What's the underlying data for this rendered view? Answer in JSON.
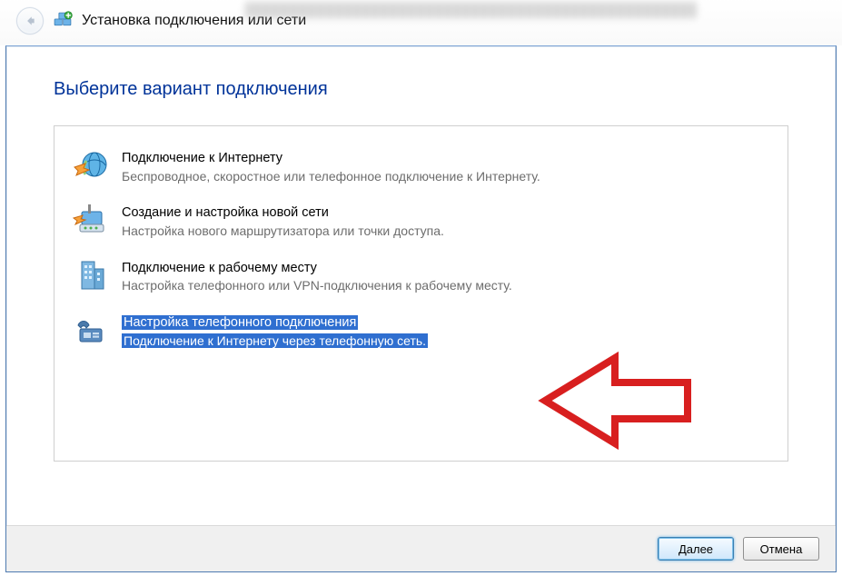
{
  "window": {
    "title": "Установка подключения или сети"
  },
  "heading": "Выберите вариант подключения",
  "options": [
    {
      "icon": "globe-arrow-icon",
      "title": "Подключение к Интернету",
      "desc": "Беспроводное, скоростное или телефонное подключение к Интернету.",
      "selected": false
    },
    {
      "icon": "router-icon",
      "title": "Создание и настройка новой сети",
      "desc": "Настройка нового маршрутизатора или точки доступа.",
      "selected": false
    },
    {
      "icon": "building-icon",
      "title": "Подключение к рабочему месту",
      "desc": "Настройка телефонного или VPN-подключения к рабочему месту.",
      "selected": false
    },
    {
      "icon": "phone-modem-icon",
      "title": "Настройка телефонного подключения",
      "desc": "Подключение к Интернету через телефонную сеть.",
      "selected": true
    }
  ],
  "footer": {
    "next": "Далее",
    "cancel": "Отмена"
  }
}
